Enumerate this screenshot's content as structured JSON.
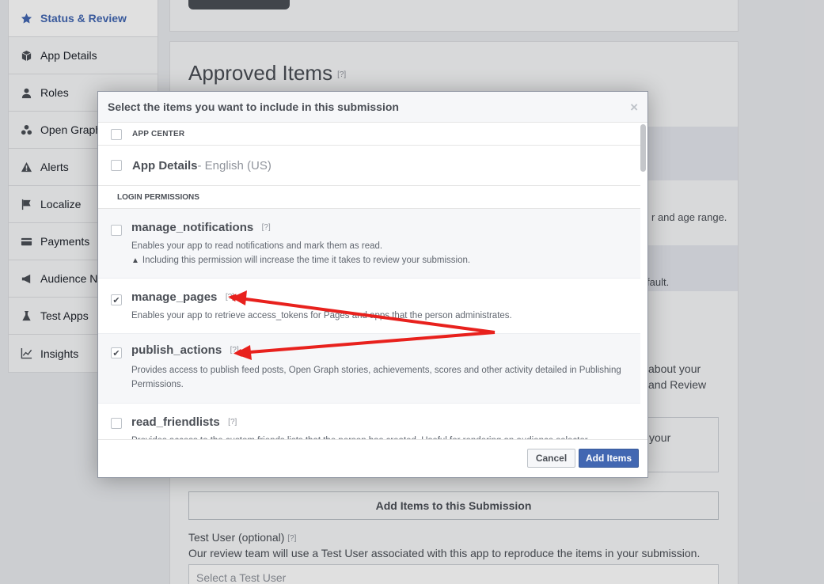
{
  "sidebar": {
    "items": [
      {
        "label": "Status & Review",
        "icon": "star-icon"
      },
      {
        "label": "App Details",
        "icon": "cube-icon"
      },
      {
        "label": "Roles",
        "icon": "person-icon"
      },
      {
        "label": "Open Graph",
        "icon": "graph-icon"
      },
      {
        "label": "Alerts",
        "icon": "warning-icon"
      },
      {
        "label": "Localize",
        "icon": "flag-icon"
      },
      {
        "label": "Payments",
        "icon": "card-icon"
      },
      {
        "label": "Audience N",
        "icon": "megaphone-icon"
      },
      {
        "label": "Test Apps",
        "icon": "flask-icon"
      },
      {
        "label": "Insights",
        "icon": "chart-icon"
      }
    ]
  },
  "main": {
    "approved_title": "Approved Items",
    "help_mark": "[?]",
    "bg_text_1": "r and age range.",
    "bg_text_2": "fault.",
    "bg_text_3": "about your",
    "bg_text_4": "and Review",
    "bg_text_5": "your",
    "add_items_button": "Add Items to this Submission",
    "test_user_label": "Test User (optional)",
    "test_user_desc": "Our review team will use a Test User associated with this app to reproduce the items in your submission.",
    "test_user_placeholder": "Select a Test User"
  },
  "dialog": {
    "title": "Select the items you want to include in this submission",
    "close_glyph": "×",
    "app_center_header": "APP CENTER",
    "app_details_name": "App Details",
    "app_details_sub": " - English (US)",
    "login_header": "LOGIN PERMISSIONS",
    "permissions": [
      {
        "name": "manage_notifications",
        "help": "[?]",
        "desc": "Enables your app to read notifications and mark them as read.",
        "warning": "Including this permission will increase the time it takes to review your submission.",
        "checked": false
      },
      {
        "name": "manage_pages",
        "help": "[?]",
        "desc": "Enables your app to retrieve access_tokens for Pages and apps that the person administrates.",
        "checked": true
      },
      {
        "name": "publish_actions",
        "help": "[?]",
        "desc": "Provides access to publish feed posts, Open Graph stories, achievements, scores and other activity detailed in Publishing Permissions.",
        "checked": true
      },
      {
        "name": "read_friendlists",
        "help": "[?]",
        "desc": "Provides access to the custom friends lists that the person has created. Useful for rendering an audience selector.",
        "checked": false
      }
    ],
    "cancel_label": "Cancel",
    "add_label": "Add Items",
    "check_glyph": "✔"
  },
  "annotation": {
    "arrow_color": "#e8211d"
  }
}
